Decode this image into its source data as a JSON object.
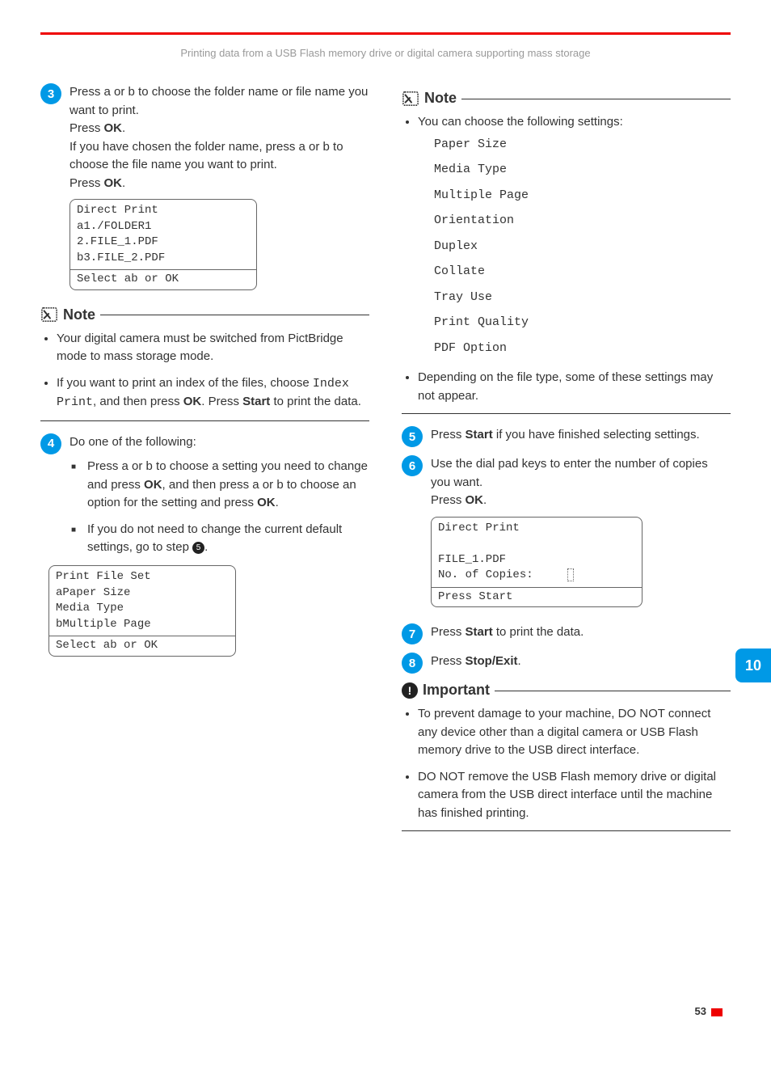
{
  "breadcrumb": "Printing data from a USB Flash memory drive or digital camera supporting mass storage",
  "steps": {
    "s3": {
      "num": "3",
      "p1a": "Press ",
      "p1b": " or ",
      "p1c": " to choose the folder name or file name you want to print.",
      "p2a": "Press ",
      "p2b": "OK",
      "p2c": ".",
      "p3a": "If you have chosen the folder name, press ",
      "p3b": " or ",
      "p3c": " to choose the file name you want to print.",
      "p4a": "Press ",
      "p4b": "OK",
      "p4c": "."
    },
    "s4": {
      "num": "4",
      "intro": "Do one of the following:",
      "b1a": "Press ",
      "b1b": " or ",
      "b1c": " to choose a setting you need to change and press ",
      "b1d": "OK",
      "b1e": ", and then press ",
      "b1f": " or ",
      "b1g": " to choose an option for the setting and press ",
      "b1h": "OK",
      "b1i": ".",
      "b2a": "If you do not need to change the current default settings, go to step ",
      "b2b": "5",
      "b2c": "."
    },
    "s5": {
      "num": "5",
      "a": "Press ",
      "b": "Start",
      "c": " if you have finished selecting settings."
    },
    "s6": {
      "num": "6",
      "a": "Use the dial pad keys to enter the number of copies you want.",
      "b": "Press ",
      "c": "OK",
      "d": "."
    },
    "s7": {
      "num": "7",
      "a": "Press ",
      "b": "Start",
      "c": " to print the data."
    },
    "s8": {
      "num": "8",
      "a": "Press ",
      "b": "Stop/Exit",
      "c": "."
    }
  },
  "lcd1": {
    "l1": "Direct Print",
    "l2": "a1./FOLDER1",
    "l3": " 2.FILE_1.PDF",
    "l4": "b3.FILE_2.PDF",
    "footer": "Select ab or OK"
  },
  "lcd2": {
    "l1": "Print File Set",
    "l2": "aPaper Size",
    "l3": " Media Type",
    "l4": "bMultiple Page",
    "footer": "Select ab or OK"
  },
  "lcd3": {
    "l1": "Direct Print",
    "l2": " FILE_1.PDF",
    "l3": "   No. of Copies:",
    "footer": "Press Start"
  },
  "note1": {
    "title": "Note",
    "b1": "Your digital camera must be switched from PictBridge mode to mass storage mode.",
    "b2a": "If you want to print an index of the files, choose ",
    "b2b": "Index Print",
    "b2c": ", and then press ",
    "b2d": "OK",
    "b2e": ". Press ",
    "b2f": "Start",
    "b2g": " to print the data."
  },
  "note2": {
    "title": "Note",
    "intro": "You can choose the following settings:",
    "settings": [
      "Paper Size",
      "Media Type",
      "Multiple Page",
      "Orientation",
      "Duplex",
      "Collate",
      "Tray Use",
      "Print Quality",
      "PDF Option"
    ],
    "b2": "Depending on the file type, some of these settings may not appear."
  },
  "important": {
    "title": "Important",
    "b1": "To prevent damage to your machine, DO NOT connect any device other than a digital camera or USB Flash memory drive to the USB direct interface.",
    "b2": "DO NOT remove the USB Flash memory drive or digital camera from the USB direct interface until the machine has finished printing."
  },
  "sideTab": "10",
  "pageNum": "53",
  "arrowUp": "a",
  "arrowDown": "b"
}
